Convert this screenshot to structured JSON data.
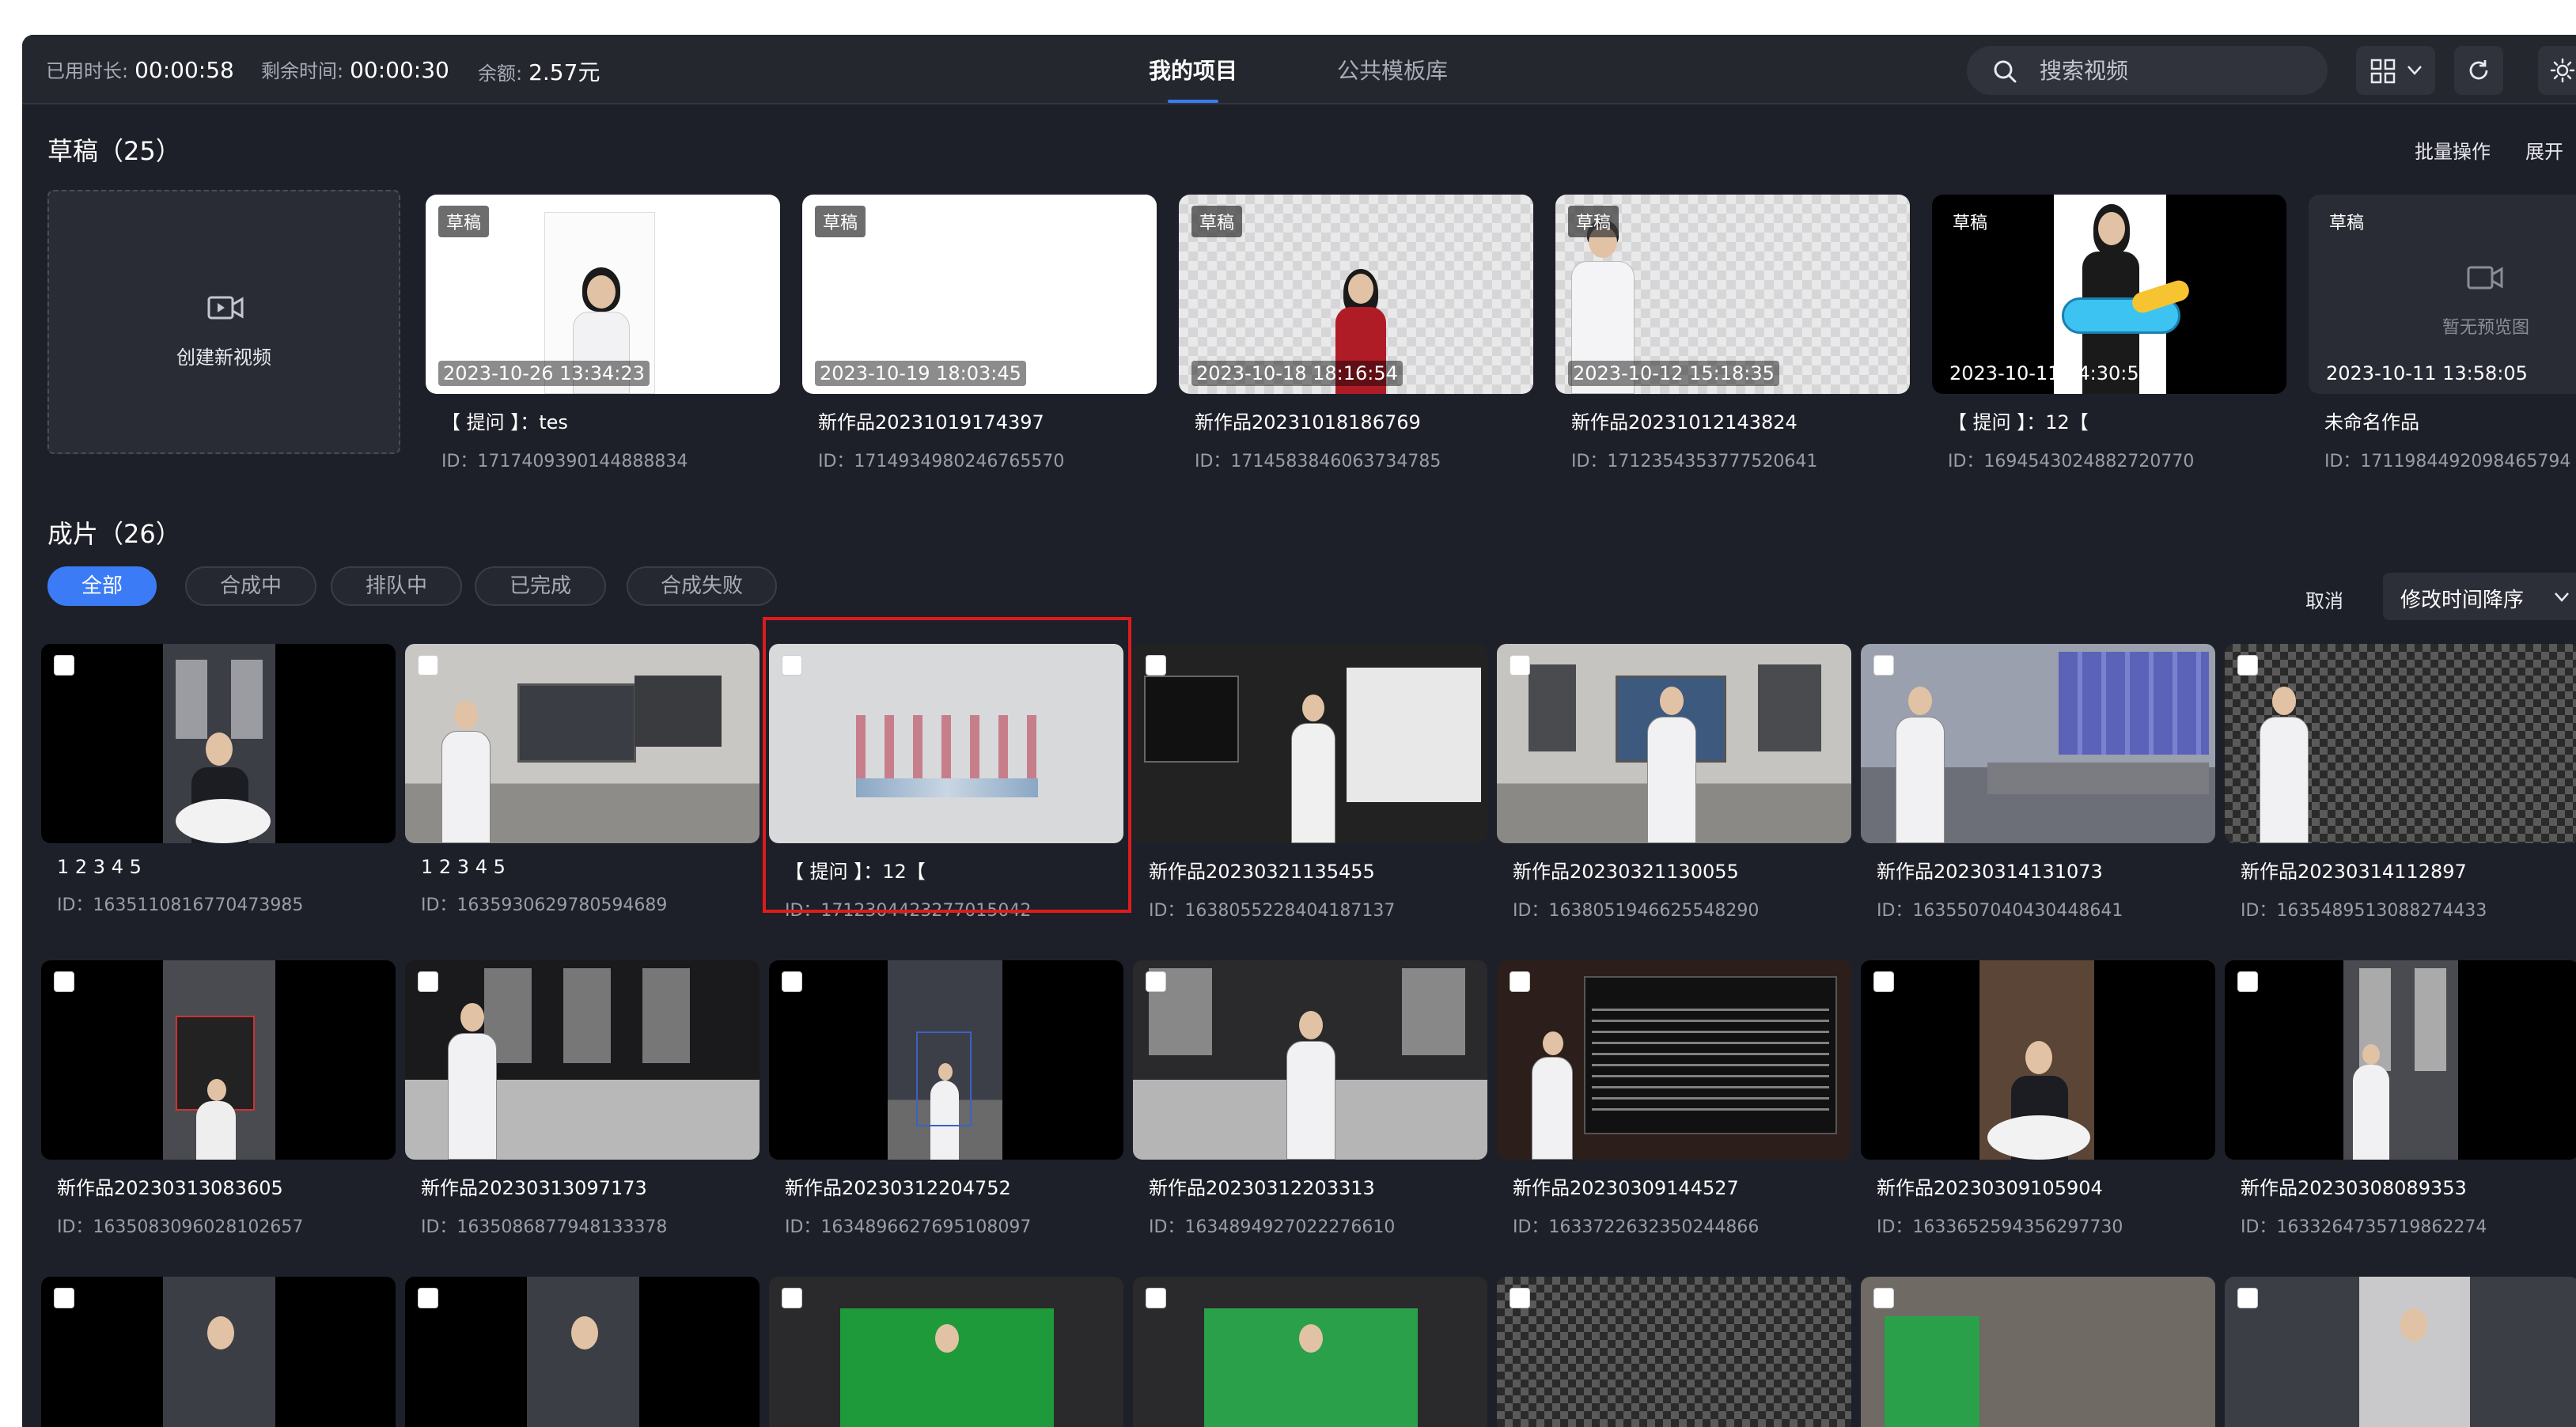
{
  "topbar": {
    "stats": [
      {
        "label": "已用时长:",
        "value": "00:00:58"
      },
      {
        "label": "剩余时间:",
        "value": "00:00:30"
      },
      {
        "label": "余额:",
        "value": "2.57元"
      }
    ],
    "tabs": [
      "我的项目",
      "公共模板库"
    ],
    "active_tab": "我的项目",
    "search_placeholder": "搜索视频"
  },
  "drafts": {
    "title": "草稿（25）",
    "batch_label": "批量操作",
    "expand_label": "展开",
    "create_label": "创建新视频",
    "no_preview_label": "暂无预览图",
    "items": [
      {
        "badge": "草稿",
        "date": "2023-10-26 13:34:23",
        "name": "【 提问 】：tes",
        "id": "ID：1717409390144888834"
      },
      {
        "badge": "草稿",
        "date": "2023-10-19 18:03:45",
        "name": "新作品20231019174397",
        "id": "ID：1714934980246765570"
      },
      {
        "badge": "草稿",
        "date": "2023-10-18 18:16:54",
        "name": "新作品20231018186769",
        "id": "ID：1714583846063734785"
      },
      {
        "badge": "草稿",
        "date": "2023-10-12 15:18:35",
        "name": "新作品20231012143824",
        "id": "ID：1712354353777520641"
      },
      {
        "badge": "草稿",
        "date": "2023-10-11 14:30:55",
        "name": "【 提问 】：12【",
        "id": "ID：1694543024882720770"
      },
      {
        "badge": "草稿",
        "date": "2023-10-11 13:58:05",
        "name": "未命名作品",
        "id": "ID：1711984492098465794"
      }
    ]
  },
  "finished": {
    "title": "成片（26）",
    "filters": [
      "全部",
      "合成中",
      "排队中",
      "已完成",
      "合成失败"
    ],
    "active_filter": "全部",
    "cancel_label": "取消",
    "sort_label": "修改时间降序",
    "rows": [
      [
        {
          "name": "1 2 3 4 5",
          "id": "ID：1635110816770473985"
        },
        {
          "name": "1 2 3 4 5",
          "id": "ID：1635930629780594689"
        },
        {
          "name": "【 提问 】：12【",
          "id": "ID：1712304423277015042"
        },
        {
          "name": "新作品20230321135455",
          "id": "ID：1638055228404187137"
        },
        {
          "name": "新作品20230321130055",
          "id": "ID：1638051946625548290"
        },
        {
          "name": "新作品20230314131073",
          "id": "ID：1635507040430448641"
        },
        {
          "name": "新作品20230314112897",
          "id": "ID：1635489513088274433"
        }
      ],
      [
        {
          "name": "新作品20230313083605",
          "id": "ID：1635083096028102657"
        },
        {
          "name": "新作品20230313097173",
          "id": "ID：1635086877948133378"
        },
        {
          "name": "新作品20230312204752",
          "id": "ID：1634896627695108097"
        },
        {
          "name": "新作品20230312203313",
          "id": "ID：1634894927022276610"
        },
        {
          "name": "新作品20230309144527",
          "id": "ID：1633722632350244866"
        },
        {
          "name": "新作品20230309105904",
          "id": "ID：1633652594356297730"
        },
        {
          "name": "新作品20230308089353",
          "id": "ID：1633264735719862274"
        }
      ]
    ]
  },
  "colors": {
    "accent": "#3b7bf6",
    "background": "#1e2029",
    "highlight": "#e01b1b"
  }
}
